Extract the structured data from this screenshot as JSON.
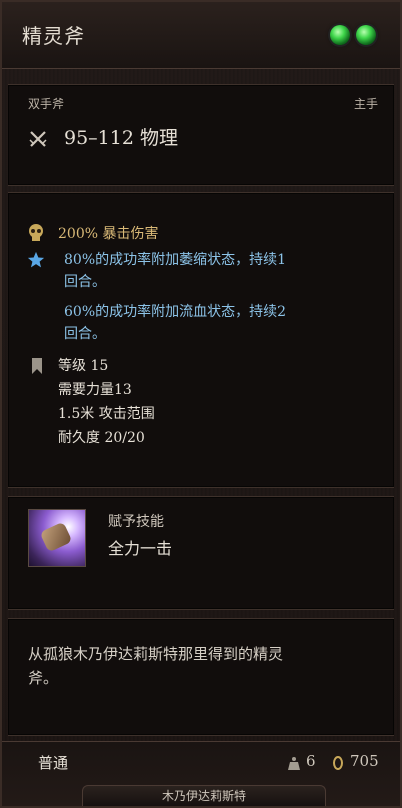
{
  "item": {
    "name": "精灵斧",
    "weapon_type": "双手斧",
    "slot": "主手",
    "damage": "95–112 物理"
  },
  "effects": {
    "crit": "200% 暴击伤害",
    "lines": [
      "80%的成功率附加萎缩状态，持续1",
      "回合。",
      "60%的成功率附加流血状态，持续2",
      "回合。"
    ]
  },
  "requirements": {
    "level": "等级 15",
    "strength": "需要力量13",
    "range": "1.5米 攻击范围",
    "durability": "耐久度 20/20"
  },
  "skill": {
    "label": "赋予技能",
    "name": "全力一击"
  },
  "description": {
    "line1": "从孤狼木乃伊达莉斯特那里得到的精灵",
    "line2": "斧。"
  },
  "footer": {
    "rarity": "普通",
    "weight": "6",
    "value": "705",
    "source": "木乃伊达莉斯特"
  },
  "icons": {
    "gems": "green-gem-icon",
    "damage": "crossed-swords-icon",
    "crit": "skull-icon",
    "status": "star-icon",
    "level": "bookmark-icon",
    "skill": "fist-skill-icon",
    "weight": "weight-icon",
    "gold": "coin-icon"
  },
  "colors": {
    "accent_gold": "#d9b977",
    "status_blue": "#8cc3e8",
    "gem_green": "#3fd64b"
  }
}
